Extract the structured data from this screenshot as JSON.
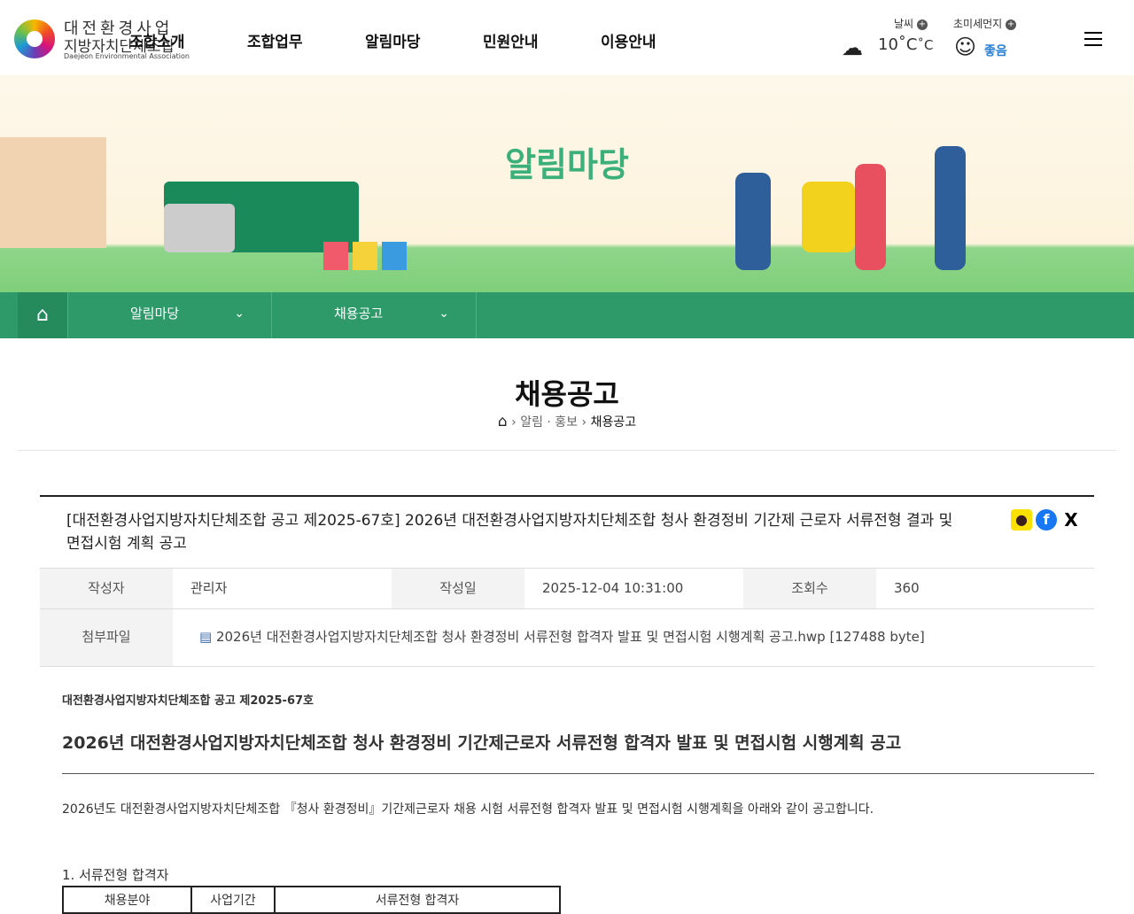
{
  "logo": {
    "line1": "대전환경사업",
    "line2": "지방자치단체조합",
    "line3": "Daejeon Environmental Association"
  },
  "gnb": [
    "조합소개",
    "조합업무",
    "알림마당",
    "민원안내",
    "이용안내"
  ],
  "weather": {
    "label": "날씨",
    "temp": "10˚C",
    "unit": "˚C",
    "dust_label": "초미세먼지",
    "dust_value": "좋음",
    "accent": "#2a7fd4"
  },
  "banner": {
    "title": "알림마당"
  },
  "subnav": {
    "depth1": "알림마당",
    "depth2": "채용공고"
  },
  "page": {
    "title": "채용공고",
    "breadcrumb": [
      "알림 · 홍보",
      "채용공고"
    ]
  },
  "article": {
    "title": "[대전환경사업지방자치단체조합 공고 제2025-67호] 2026년 대전환경사업지방자치단체조합 청사 환경정비 기간제 근로자 서류전형 결과 및 면접시험 계획 공고",
    "author_label": "작성자",
    "author": "관리자",
    "date_label": "작성일",
    "date": "2025-12-04 10:31:00",
    "views_label": "조회수",
    "views": "360",
    "file_label": "첨부파일",
    "file": "2026년 대전환경사업지방자치단체조합 청사 환경정비 서류전형 합격자 발표 및 면접시험 시행계획 공고.hwp [127488 byte]",
    "notice_no": "대전환경사업지방자치단체조합 공고 제2025-67호",
    "heading": "2026년 대전환경사업지방자치단체조합 청사 환경정비 기간제근로자 서류전형 합격자 발표 및 면접시험 시행계획 공고",
    "intro": "2026년도 대전환경사업지방자치단체조합 『청사 환경정비』기간제근로자 채용 시험 서류전형 합격자 발표 및 면접시험 시행계획을 아래와 같이 공고합니다.",
    "section1": "1. 서류전형 합격자",
    "table_headers": [
      "채용분야",
      "사업기간",
      "서류전형 합격자"
    ]
  }
}
